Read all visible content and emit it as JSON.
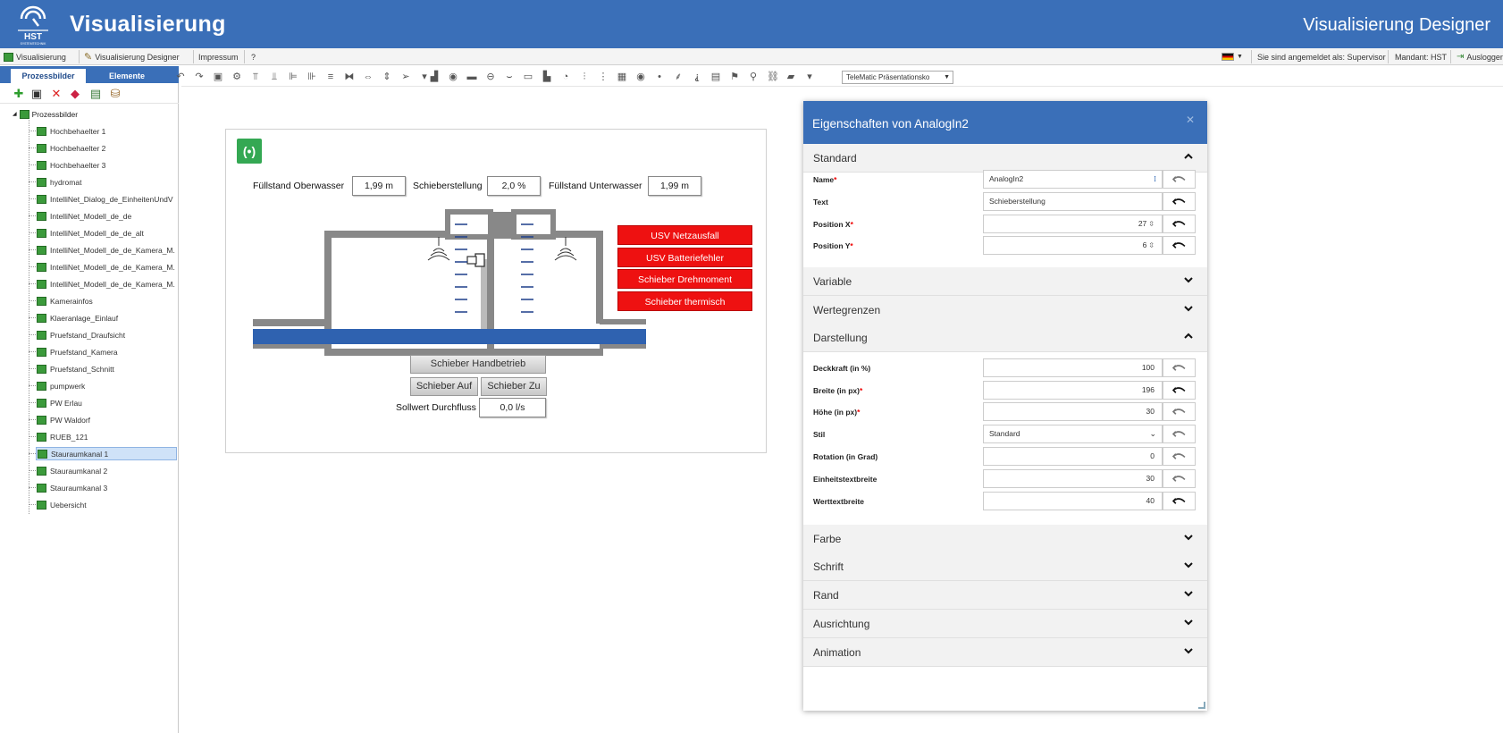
{
  "header": {
    "logo_text": "HST",
    "logo_subtext": "SYSTEMTECHNIK",
    "title": "Visualisierung",
    "right_title": "Visualisierung Designer"
  },
  "menubar": {
    "items": [
      "Visualisierung",
      "Visualisierung Designer",
      "Impressum",
      "?"
    ],
    "login_text": "Sie sind angemeldet als: Supervisor",
    "mandant": "Mandant: HST",
    "logout": "Ausloggen"
  },
  "leftpanel": {
    "tabs": [
      "Prozessbilder",
      "Elemente"
    ],
    "root_label": "Prozessbilder",
    "items": [
      "Hochbehaelter 1",
      "Hochbehaelter 2",
      "Hochbehaelter 3",
      "hydromat",
      "IntelliNet_Dialog_de_EinheitenUndV",
      "IntelliNet_Modell_de_de",
      "IntelliNet_Modell_de_de_alt",
      "IntelliNet_Modell_de_de_Kamera_M.",
      "IntelliNet_Modell_de_de_Kamera_M.",
      "IntelliNet_Modell_de_de_Kamera_M.",
      "Kamerainfos",
      "Klaeranlage_Einlauf",
      "Pruefstand_Draufsicht",
      "Pruefstand_Kamera",
      "Pruefstand_Schnitt",
      "pumpwerk",
      "PW Erlau",
      "PW Waldorf",
      "RUEB_121",
      "Stauraumkanal 1",
      "Stauraumkanal 2",
      "Stauraumkanal 3",
      "Uebersicht"
    ],
    "selected_index": 19
  },
  "toolbar": {
    "preset_select": "TeleMatic Präsentationsko"
  },
  "canvas": {
    "fill_upper_label": "Füllstand Oberwasser",
    "fill_upper_value": "1,99 m",
    "slider_label": "Schieberstellung",
    "slider_value": "2,0 %",
    "fill_lower_label": "Füllstand Unterwasser",
    "fill_lower_value": "1,99 m",
    "alarms": [
      "USV Netzausfall",
      "USV Batteriefehler",
      "Schieber Drehmoment",
      "Schieber thermisch"
    ],
    "btn_manual": "Schieber Handbetrieb",
    "btn_open": "Schieber Auf",
    "btn_close": "Schieber Zu",
    "flow_label": "Sollwert Durchfluss",
    "flow_value": "0,0 l/s"
  },
  "dialog": {
    "title": "Eigenschaften von AnalogIn2",
    "sections": {
      "standard": "Standard",
      "variable": "Variable",
      "wertegrenzen": "Wertegrenzen",
      "darstellung": "Darstellung",
      "farbe": "Farbe",
      "schrift": "Schrift",
      "rand": "Rand",
      "ausrichtung": "Ausrichtung",
      "animation": "Animation"
    },
    "standard_props": [
      {
        "label": "Name",
        "required": true,
        "value": "AnalogIn2"
      },
      {
        "label": "Text",
        "required": false,
        "value": "Schieberstellung"
      },
      {
        "label": "Position X",
        "required": true,
        "value": "27"
      },
      {
        "label": "Position Y",
        "required": true,
        "value": "6"
      }
    ],
    "darstellung_props": [
      {
        "label": "Deckkraft (in %)",
        "required": false,
        "value": "100"
      },
      {
        "label": "Breite (in px)",
        "required": true,
        "value": "196"
      },
      {
        "label": "Höhe (in px)",
        "required": true,
        "value": "30"
      },
      {
        "label": "Stil",
        "required": false,
        "value": "Standard"
      },
      {
        "label": "Rotation (in Grad)",
        "required": false,
        "value": "0"
      },
      {
        "label": "Einheitstextbreite",
        "required": false,
        "value": "30"
      },
      {
        "label": "Werttextbreite",
        "required": false,
        "value": "40"
      }
    ]
  },
  "colors": {
    "brand_blue": "#3a6fb8",
    "alarm_red": "#ee1111",
    "water_blue": "#2f62b0",
    "signal_green": "#34a853"
  }
}
